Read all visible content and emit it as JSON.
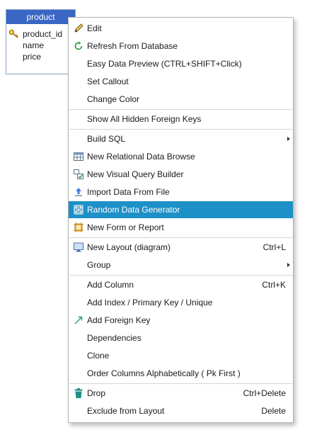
{
  "entity": {
    "title": "product",
    "columns": [
      "product_id",
      "name",
      "price"
    ]
  },
  "menu": {
    "items": [
      {
        "label": "Edit",
        "icon": "pencil-icon"
      },
      {
        "label": "Refresh From Database",
        "icon": "refresh-icon"
      },
      {
        "label": "Easy Data Preview (CTRL+SHIFT+Click)"
      },
      {
        "label": "Set Callout"
      },
      {
        "label": "Change Color"
      },
      {
        "label": "Show All Hidden Foreign Keys"
      },
      {
        "label": "Build SQL",
        "submenu": true
      },
      {
        "label": "New Relational Data Browse",
        "icon": "table-grid-icon"
      },
      {
        "label": "New Visual Query Builder",
        "icon": "query-builder-icon"
      },
      {
        "label": "Import Data From File",
        "icon": "import-icon"
      },
      {
        "label": "Random Data Generator",
        "icon": "dice-icon",
        "highlighted": true
      },
      {
        "label": "New Form or Report",
        "icon": "form-icon"
      },
      {
        "label": "New Layout (diagram)",
        "icon": "monitor-icon",
        "shortcut": "Ctrl+L"
      },
      {
        "label": "Group",
        "submenu": true
      },
      {
        "label": "Add Column",
        "shortcut": "Ctrl+K"
      },
      {
        "label": "Add Index / Primary Key / Unique"
      },
      {
        "label": "Add Foreign Key",
        "icon": "foreign-key-arrow-icon"
      },
      {
        "label": "Dependencies"
      },
      {
        "label": "Clone"
      },
      {
        "label": "Order Columns Alphabetically ( Pk First )"
      },
      {
        "label": "Drop",
        "icon": "trash-icon",
        "shortcut": "Ctrl+Delete"
      },
      {
        "label": "Exclude from Layout",
        "shortcut": "Delete"
      }
    ]
  },
  "colors": {
    "entity_header": "#3a66c4",
    "highlight": "#1e90c8"
  }
}
